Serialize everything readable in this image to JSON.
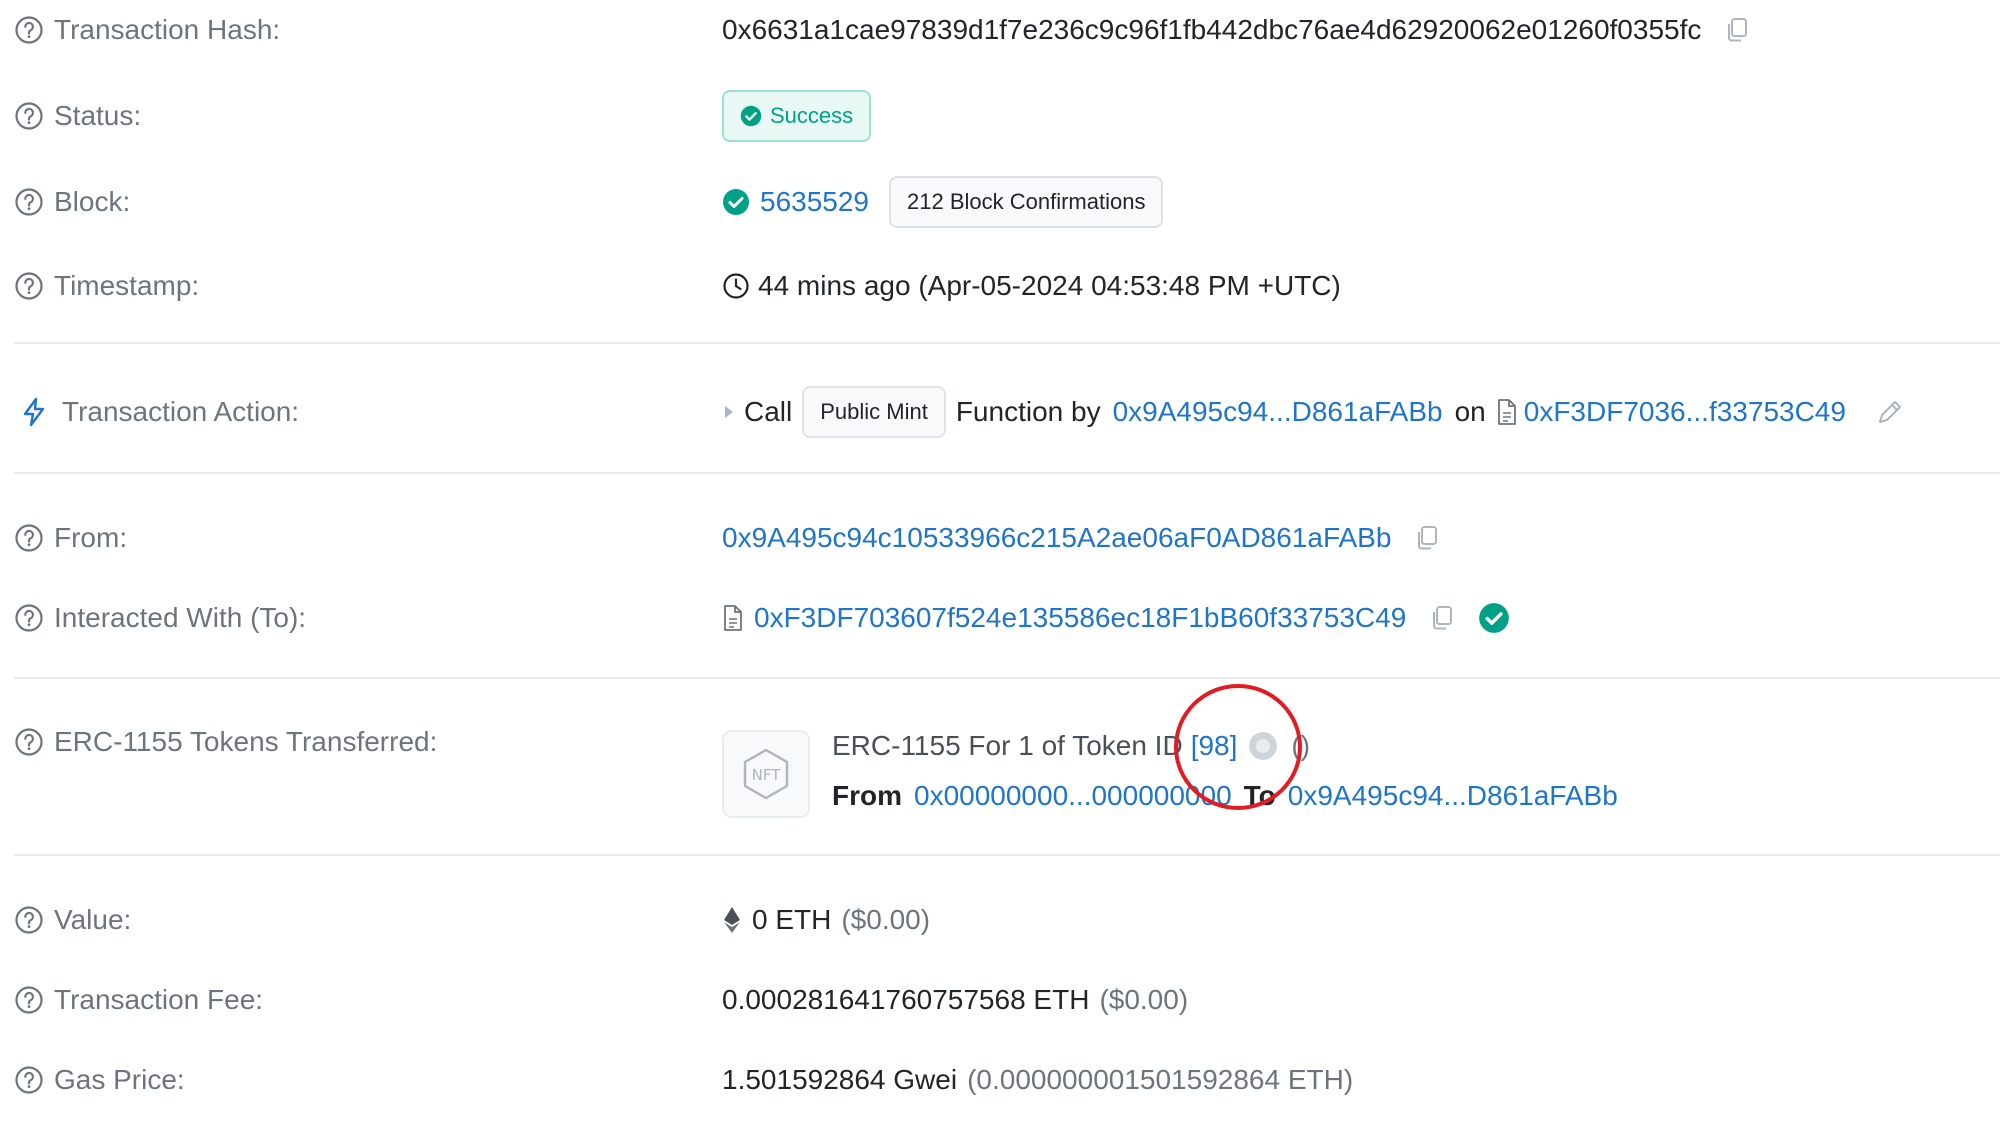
{
  "colors": {
    "link": "#1f75c9",
    "success": "#00a186",
    "muted": "#6c757d",
    "annotation": "#e31b23"
  },
  "fields": {
    "tx_hash": {
      "label": "Transaction Hash:",
      "value": "0x6631a1cae97839d1f7e236c9c96f1fb442dbc76ae4d62920062e01260f0355fc"
    },
    "status": {
      "label": "Status:",
      "value": "Success"
    },
    "block": {
      "label": "Block:",
      "number": "5635529",
      "confirmations": "212 Block Confirmations"
    },
    "timestamp": {
      "label": "Timestamp:",
      "value": "44 mins ago (Apr-05-2024 04:53:48 PM +UTC)"
    },
    "action": {
      "label": "Transaction Action:",
      "call": "Call",
      "method": "Public Mint",
      "function_by": "Function by",
      "caller": "0x9A495c94...D861aFABb",
      "on": "on",
      "contract": "0xF3DF7036...f33753C49"
    },
    "from": {
      "label": "From:",
      "value": "0x9A495c94c10533966c215A2ae06aF0AD861aFABb"
    },
    "to": {
      "label": "Interacted With (To):",
      "value": "0xF3DF703607f524e135586ec18F1bB60f33753C49"
    },
    "erc1155": {
      "label": "ERC-1155 Tokens Transferred:",
      "nft_badge": "NFT",
      "line1_prefix": "ERC-1155 For 1 of Token ID",
      "token_id": "[98]",
      "token_name": "()",
      "from_label": "From",
      "from_addr": "0x00000000...000000000",
      "to_label": "To",
      "to_addr": "0x9A495c94...D861aFABb"
    },
    "value": {
      "label": "Value:",
      "amount": "0 ETH",
      "usd": "($0.00)"
    },
    "fee": {
      "label": "Transaction Fee:",
      "amount": "0.000281641760757568 ETH",
      "usd": "($0.00)"
    },
    "gas_price": {
      "label": "Gas Price:",
      "amount": "1.501592864 Gwei",
      "eth": "(0.000000001501592864 ETH)"
    }
  }
}
